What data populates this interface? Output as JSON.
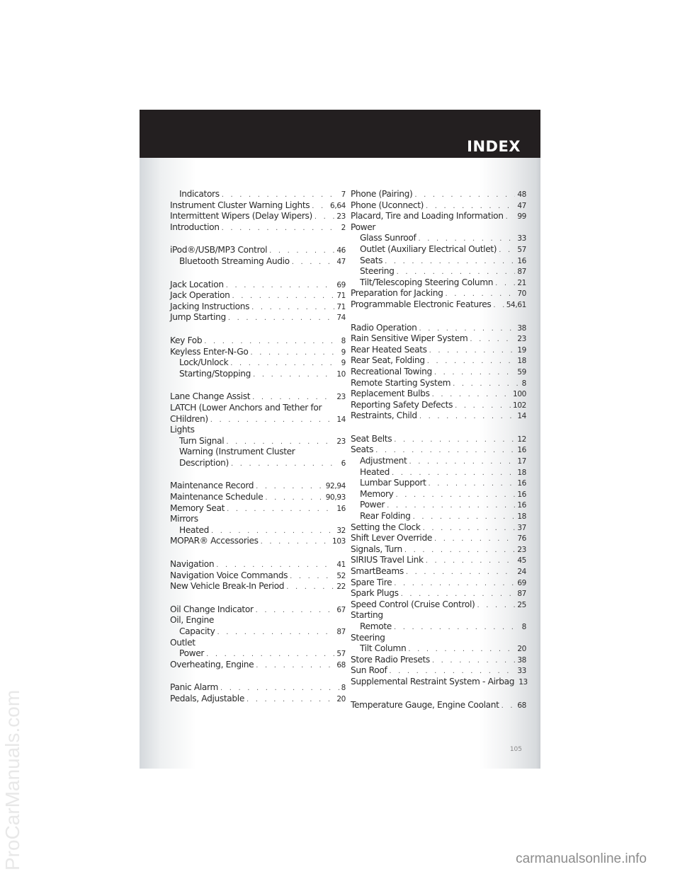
{
  "header": {
    "title": "INDEX"
  },
  "left_column": [
    {
      "label": "Indicators",
      "page": "7",
      "sub": true
    },
    {
      "label": "Instrument Cluster Warning Lights",
      "page": "6,64"
    },
    {
      "label": "Intermittent Wipers (Delay Wipers)",
      "page": "23"
    },
    {
      "label": "Introduction",
      "page": "2"
    },
    {
      "gap": true
    },
    {
      "label": "iPod®/USB/MP3 Control",
      "page": "46"
    },
    {
      "label": "Bluetooth Streaming Audio",
      "page": "47",
      "sub": true
    },
    {
      "gap": true
    },
    {
      "label": "Jack Location",
      "page": "69"
    },
    {
      "label": "Jack Operation",
      "page": "71"
    },
    {
      "label": "Jacking Instructions",
      "page": "71"
    },
    {
      "label": "Jump Starting",
      "page": "74"
    },
    {
      "gap": true
    },
    {
      "label": "Key Fob",
      "page": "8"
    },
    {
      "label": "Keyless Enter-N-Go",
      "page": "9"
    },
    {
      "label": "Lock/Unlock",
      "page": "9",
      "sub": true
    },
    {
      "label": "Starting/Stopping",
      "page": "10",
      "sub": true
    },
    {
      "gap": true
    },
    {
      "label": "Lane Change Assist",
      "page": "23"
    },
    {
      "label": "LATCH (Lower Anchors and Tether for",
      "page": ""
    },
    {
      "label": "CHildren)",
      "page": "14"
    },
    {
      "label": "Lights",
      "page": ""
    },
    {
      "label": "Turn Signal",
      "page": "23",
      "sub": true
    },
    {
      "label": "Warning (Instrument Cluster",
      "page": "",
      "sub": true
    },
    {
      "label": "Description)",
      "page": "6",
      "sub": true
    },
    {
      "gap": true
    },
    {
      "label": "Maintenance Record",
      "page": "92,94"
    },
    {
      "label": "Maintenance Schedule",
      "page": "90,93"
    },
    {
      "label": "Memory Seat",
      "page": "16"
    },
    {
      "label": "Mirrors",
      "page": ""
    },
    {
      "label": "Heated",
      "page": "32",
      "sub": true
    },
    {
      "label": "MOPAR® Accessories",
      "page": "103"
    },
    {
      "gap": true
    },
    {
      "label": "Navigation",
      "page": "41"
    },
    {
      "label": "Navigation Voice Commands",
      "page": "52"
    },
    {
      "label": "New Vehicle Break-In Period",
      "page": "22"
    },
    {
      "gap": true
    },
    {
      "label": "Oil Change Indicator",
      "page": "67"
    },
    {
      "label": "Oil, Engine",
      "page": ""
    },
    {
      "label": "Capacity",
      "page": "87",
      "sub": true
    },
    {
      "label": "Outlet",
      "page": ""
    },
    {
      "label": "Power",
      "page": "57",
      "sub": true
    },
    {
      "label": "Overheating, Engine",
      "page": "68"
    },
    {
      "gap": true
    },
    {
      "label": "Panic Alarm",
      "page": "8"
    },
    {
      "label": "Pedals, Adjustable",
      "page": "20"
    }
  ],
  "right_column": [
    {
      "label": "Phone (Pairing)",
      "page": "48"
    },
    {
      "label": "Phone (Uconnect)",
      "page": "47"
    },
    {
      "label": "Placard, Tire and Loading Information",
      "page": "99"
    },
    {
      "label": "Power",
      "page": ""
    },
    {
      "label": "Glass Sunroof",
      "page": "33",
      "sub": true
    },
    {
      "label": "Outlet (Auxiliary Electrical Outlet)",
      "page": "57",
      "sub": true
    },
    {
      "label": "Seats",
      "page": "16",
      "sub": true
    },
    {
      "label": "Steering",
      "page": "87",
      "sub": true
    },
    {
      "label": "Tilt/Telescoping Steering Column",
      "page": "21",
      "sub": true
    },
    {
      "label": "Preparation for Jacking",
      "page": "70"
    },
    {
      "label": "Programmable Electronic Features",
      "page": "54,61"
    },
    {
      "gap": true
    },
    {
      "label": "Radio Operation",
      "page": "38"
    },
    {
      "label": "Rain Sensitive Wiper System",
      "page": "23"
    },
    {
      "label": "Rear Heated Seats",
      "page": "19"
    },
    {
      "label": "Rear Seat, Folding",
      "page": "18"
    },
    {
      "label": "Recreational Towing",
      "page": "59"
    },
    {
      "label": "Remote Starting System",
      "page": "8"
    },
    {
      "label": "Replacement Bulbs",
      "page": "100"
    },
    {
      "label": "Reporting Safety Defects",
      "page": "102"
    },
    {
      "label": "Restraints, Child",
      "page": "14"
    },
    {
      "gap": true
    },
    {
      "label": "Seat Belts",
      "page": "12"
    },
    {
      "label": "Seats",
      "page": "16"
    },
    {
      "label": "Adjustment",
      "page": "17",
      "sub": true
    },
    {
      "label": "Heated",
      "page": "18",
      "sub": true
    },
    {
      "label": "Lumbar Support",
      "page": "16",
      "sub": true
    },
    {
      "label": "Memory",
      "page": "16",
      "sub": true
    },
    {
      "label": "Power",
      "page": "16",
      "sub": true
    },
    {
      "label": "Rear Folding",
      "page": "18",
      "sub": true
    },
    {
      "label": "Setting the Clock",
      "page": "37"
    },
    {
      "label": "Shift Lever Override",
      "page": "76"
    },
    {
      "label": "Signals, Turn",
      "page": "23"
    },
    {
      "label": "SIRIUS Travel Link",
      "page": "45"
    },
    {
      "label": "SmartBeams",
      "page": "24"
    },
    {
      "label": "Spare Tire",
      "page": "69"
    },
    {
      "label": "Spark Plugs",
      "page": "87"
    },
    {
      "label": "Speed Control (Cruise Control)",
      "page": "25"
    },
    {
      "label": "Starting",
      "page": ""
    },
    {
      "label": "Remote",
      "page": "8",
      "sub": true
    },
    {
      "label": "Steering",
      "page": ""
    },
    {
      "label": "Tilt Column",
      "page": "20",
      "sub": true
    },
    {
      "label": "Store Radio Presets",
      "page": "38"
    },
    {
      "label": "Sun Roof",
      "page": "33"
    },
    {
      "label": "Supplemental Restraint System - Airbag",
      "page": "13"
    },
    {
      "gap": true
    },
    {
      "label": "Temperature Gauge, Engine Coolant",
      "page": "68"
    }
  ],
  "footer": {
    "page_number": "105"
  },
  "watermarks": {
    "side": "ProCarManuals.com",
    "bottom": "carmanualsonline.info"
  }
}
